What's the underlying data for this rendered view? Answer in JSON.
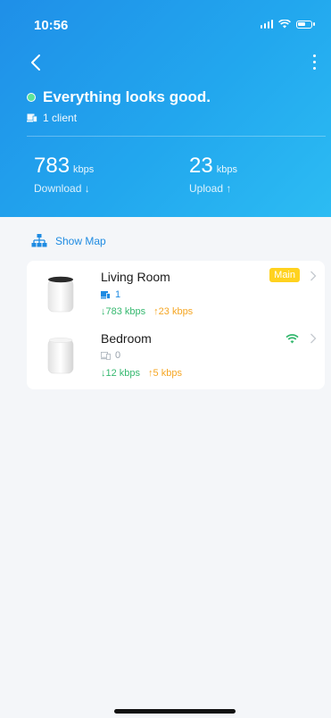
{
  "status_bar": {
    "time": "10:56"
  },
  "header": {
    "status_text": "Everything looks good.",
    "client_count": "1 client",
    "download": {
      "value": "783",
      "unit": "kbps",
      "label": "Download ↓"
    },
    "upload": {
      "value": "23",
      "unit": "kbps",
      "label": "Upload ↑"
    }
  },
  "show_map_label": "Show Map",
  "devices": [
    {
      "name": "Living Room",
      "badge": "Main",
      "clients": "1",
      "download": "↓783 kbps",
      "upload": "↑23 kbps"
    },
    {
      "name": "Bedroom",
      "clients": "0",
      "download": "↓12 kbps",
      "upload": "↑5 kbps",
      "signal_icon": "wifi-icon"
    }
  ],
  "colors": {
    "accent": "#1e8be2",
    "status_dot": "#5ee59a",
    "download": "#35b86f",
    "upload": "#f5a623",
    "badge": "#ffd21f"
  }
}
